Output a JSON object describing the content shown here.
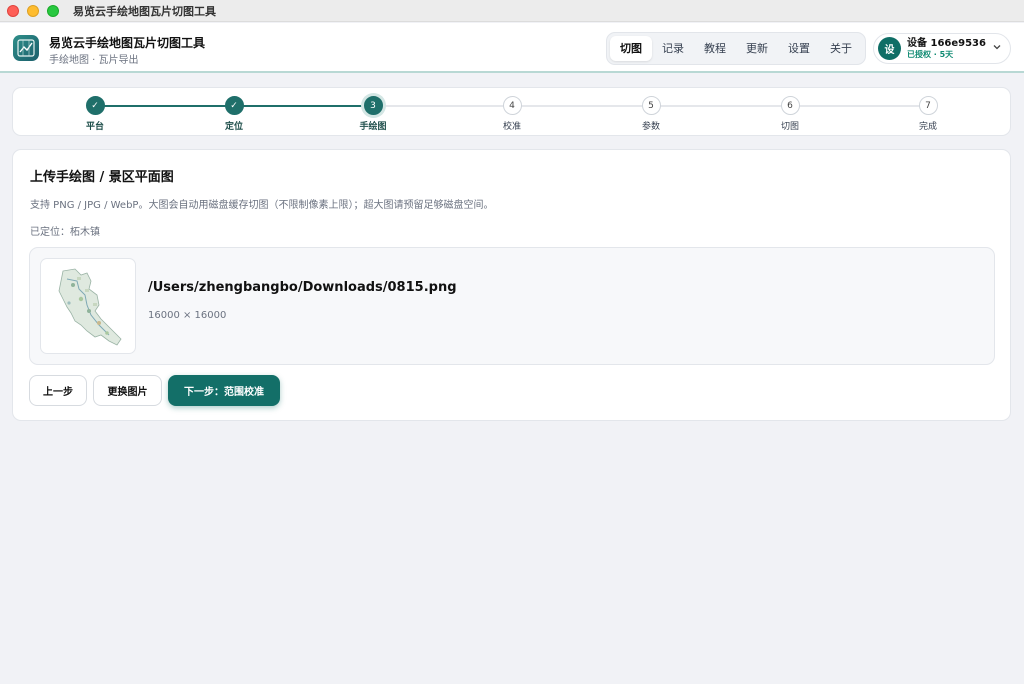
{
  "window": {
    "title": "易览云手绘地图瓦片切图工具"
  },
  "header": {
    "title": "易览云手绘地图瓦片切图工具",
    "subtitle": "手绘地图 · 瓦片导出",
    "accent_color": "#1f6f6a"
  },
  "nav": {
    "items": [
      {
        "label": "切图",
        "active": true
      },
      {
        "label": "记录",
        "active": false
      },
      {
        "label": "教程",
        "active": false
      },
      {
        "label": "更新",
        "active": false
      },
      {
        "label": "设置",
        "active": false
      },
      {
        "label": "关于",
        "active": false
      }
    ]
  },
  "device": {
    "avatar": "设",
    "name": "设备 166e9536",
    "status": "已授权 · 5天",
    "icon": "chevron-down-icon"
  },
  "stepper": {
    "current_step": 3,
    "steps": [
      {
        "label": "平台",
        "state": "done",
        "marker": "✓"
      },
      {
        "label": "定位",
        "state": "done",
        "marker": "✓"
      },
      {
        "label": "手绘图",
        "state": "current",
        "marker": "3"
      },
      {
        "label": "校准",
        "state": "pending",
        "marker": "4"
      },
      {
        "label": "参数",
        "state": "pending",
        "marker": "5"
      },
      {
        "label": "切图",
        "state": "pending",
        "marker": "6"
      },
      {
        "label": "完成",
        "state": "pending",
        "marker": "7"
      }
    ]
  },
  "card": {
    "title": "上传手绘图 / 景区平面图",
    "description": "支持 PNG / JPG / WebP。大图会自动用磁盘缓存切图（不限制像素上限）；超大图请预留足够磁盘空间。",
    "location": "已定位：柘木镇",
    "file": {
      "path": "/Users/zhengbangbo/Downloads/0815.png",
      "dimensions": "16000 × 16000"
    }
  },
  "actions": {
    "prev": "上一步",
    "replace": "更换图片",
    "next": "下一步：范围校准"
  }
}
